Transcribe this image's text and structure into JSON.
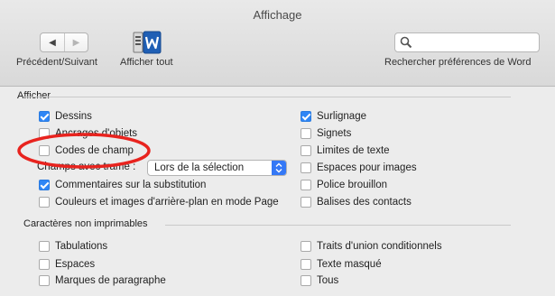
{
  "window": {
    "title": "Affichage"
  },
  "toolbar": {
    "nav_label": "Précédent/Suivant",
    "nav_prev_glyph": "◀",
    "nav_next_glyph": "▶",
    "show_all_label": "Afficher tout",
    "search_placeholder": "",
    "search_label": "Rechercher préférences de Word"
  },
  "afficher": {
    "title": "Afficher",
    "left": [
      {
        "label": "Dessins",
        "checked": true
      },
      {
        "label": "Ancrages d'objets",
        "checked": false
      },
      {
        "label": "Codes de champ",
        "checked": false
      }
    ],
    "champs_label": "Champs avec trame :",
    "champs_value": "Lors de la sélection",
    "left_bottom": [
      {
        "label": "Commentaires sur la substitution",
        "checked": true
      },
      {
        "label": "Couleurs et images d'arrière-plan en mode Page",
        "checked": false
      }
    ],
    "right": [
      {
        "label": "Surlignage",
        "checked": true
      },
      {
        "label": "Signets",
        "checked": false
      },
      {
        "label": "Limites de texte",
        "checked": false
      },
      {
        "label": "Espaces pour images",
        "checked": false
      },
      {
        "label": "Police brouillon",
        "checked": false
      },
      {
        "label": "Balises des contacts",
        "checked": false
      }
    ]
  },
  "nonprint": {
    "title": "Caractères non imprimables",
    "left": [
      {
        "label": "Tabulations",
        "checked": false
      },
      {
        "label": "Espaces",
        "checked": false
      },
      {
        "label": "Marques de paragraphe",
        "checked": false
      }
    ],
    "right": [
      {
        "label": "Traits d'union conditionnels",
        "checked": false
      },
      {
        "label": "Texte masqué",
        "checked": false
      },
      {
        "label": "Tous",
        "checked": false
      }
    ]
  },
  "colors": {
    "accent": "#2f86f6",
    "annotation": "#e8231e"
  }
}
